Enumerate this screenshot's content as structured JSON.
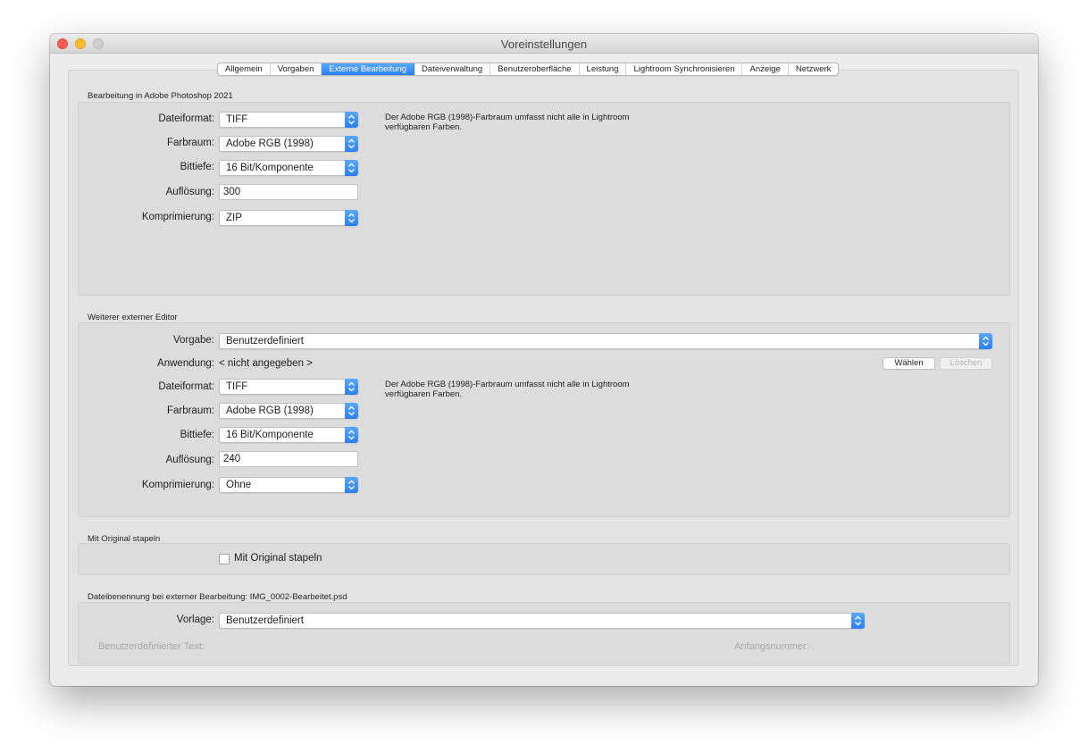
{
  "window": {
    "title": "Voreinstellungen"
  },
  "tabs": [
    {
      "label": "Allgemein",
      "active": false
    },
    {
      "label": "Vorgaben",
      "active": false
    },
    {
      "label": "Externe Bearbeitung",
      "active": true
    },
    {
      "label": "Dateiverwaltung",
      "active": false
    },
    {
      "label": "Benutzeroberfläche",
      "active": false
    },
    {
      "label": "Leistung",
      "active": false
    },
    {
      "label": "Lightroom Synchronisieren",
      "active": false
    },
    {
      "label": "Anzeige",
      "active": false
    },
    {
      "label": "Netzwerk",
      "active": false
    }
  ],
  "photoshop": {
    "section_title": "Bearbeitung in Adobe Photoshop 2021",
    "dateiformat_label": "Dateiformat:",
    "dateiformat_value": "TIFF",
    "farbraum_label": "Farbraum:",
    "farbraum_value": "Adobe RGB (1998)",
    "bittiefe_label": "Bittiefe:",
    "bittiefe_value": "16 Bit/Komponente",
    "aufloesung_label": "Auflösung:",
    "aufloesung_value": "300",
    "komprimierung_label": "Komprimierung:",
    "komprimierung_value": "ZIP",
    "note": "Der Adobe RGB (1998)-Farbraum umfasst nicht alle in Lightroom verfügbaren Farben."
  },
  "external_editor": {
    "section_title": "Weiterer externer Editor",
    "vorgabe_label": "Vorgabe:",
    "vorgabe_value": "Benutzerdefiniert",
    "anwendung_label": "Anwendung:",
    "anwendung_value": "< nicht angegeben >",
    "waehlen_label": "Wählen",
    "loeschen_label": "Löschen",
    "dateiformat_label": "Dateiformat:",
    "dateiformat_value": "TIFF",
    "farbraum_label": "Farbraum:",
    "farbraum_value": "Adobe RGB (1998)",
    "bittiefe_label": "Bittiefe:",
    "bittiefe_value": "16 Bit/Komponente",
    "aufloesung_label": "Auflösung:",
    "aufloesung_value": "240",
    "komprimierung_label": "Komprimierung:",
    "komprimierung_value": "Ohne",
    "note": "Der Adobe RGB (1998)-Farbraum umfasst nicht alle in Lightroom verfügbaren Farben."
  },
  "stack": {
    "section_title": "Mit Original stapeln",
    "checkbox_label": "Mit Original stapeln",
    "checked": false
  },
  "naming": {
    "section_title": "Dateibenennung bei externer Bearbeitung: IMG_0002-Bearbeitet.psd",
    "vorlage_label": "Vorlage:",
    "vorlage_value": "Benutzerdefiniert",
    "custom_text_label": "Benutzerdefinierter Text:",
    "start_number_label": "Anfangsnummer:"
  },
  "colors": {
    "accent": "#2b7ff4",
    "close": "#fc5f57",
    "minimize": "#fdbc2e"
  }
}
